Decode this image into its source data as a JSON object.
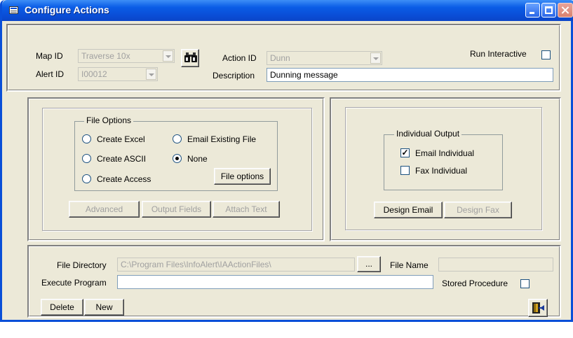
{
  "window": {
    "title": "Configure Actions"
  },
  "header": {
    "map_id_label": "Map ID",
    "map_id_value": "Traverse 10x",
    "alert_id_label": "Alert ID",
    "alert_id_value": "I00012",
    "action_id_label": "Action ID",
    "action_id_value": "Dunn",
    "description_label": "Description",
    "description_value": "Dunning message",
    "run_interactive_label": "Run Interactive",
    "run_interactive_checked": false,
    "search_icon": "binoculars-icon"
  },
  "file_options": {
    "legend": "File Options",
    "radios": [
      {
        "label": "Create Excel",
        "selected": false
      },
      {
        "label": "Create ASCII",
        "selected": false
      },
      {
        "label": "Create Access",
        "selected": false
      },
      {
        "label": "Email Existing File",
        "selected": false
      },
      {
        "label": "None",
        "selected": true
      }
    ],
    "file_options_button": "File options",
    "advanced_button": "Advanced",
    "output_fields_button": "Output Fields",
    "attach_text_button": "Attach Text"
  },
  "individual_output": {
    "legend": "Individual Output",
    "email_individual_label": "Email Individual",
    "email_individual_checked": true,
    "check_mark": "✓",
    "fax_individual_label": "Fax Individual",
    "fax_individual_checked": false,
    "design_email_button": "Design Email",
    "design_fax_button": "Design Fax"
  },
  "bottom": {
    "file_directory_label": "File Directory",
    "file_directory_value": "C:\\Program Files\\InfoAlert\\IAActionFiles\\",
    "browse_button": "...",
    "file_name_label": "File Name",
    "file_name_value": "",
    "execute_program_label": "Execute Program",
    "execute_program_value": "",
    "stored_procedure_label": "Stored Procedure",
    "stored_procedure_checked": false,
    "delete_button": "Delete",
    "new_button": "New",
    "exit_icon": "exit-door-icon"
  },
  "colors": {
    "titlebar": "#0a4fd8",
    "window_bg": "#ece9d8",
    "field_border": "#7f9db9",
    "disabled_text": "#a0a0a0"
  }
}
